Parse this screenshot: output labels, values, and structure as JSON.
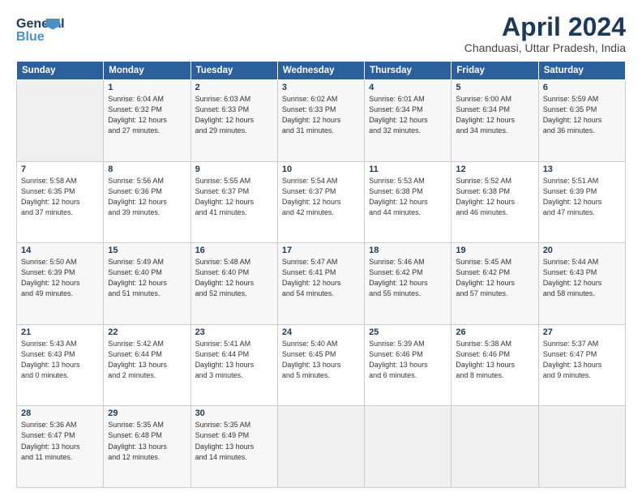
{
  "logo": {
    "line1": "General",
    "line2": "Blue"
  },
  "title": "April 2024",
  "subtitle": "Chanduasi, Uttar Pradesh, India",
  "columns": [
    "Sunday",
    "Monday",
    "Tuesday",
    "Wednesday",
    "Thursday",
    "Friday",
    "Saturday"
  ],
  "weeks": [
    [
      {
        "day": "",
        "info": ""
      },
      {
        "day": "1",
        "info": "Sunrise: 6:04 AM\nSunset: 6:32 PM\nDaylight: 12 hours\nand 27 minutes."
      },
      {
        "day": "2",
        "info": "Sunrise: 6:03 AM\nSunset: 6:33 PM\nDaylight: 12 hours\nand 29 minutes."
      },
      {
        "day": "3",
        "info": "Sunrise: 6:02 AM\nSunset: 6:33 PM\nDaylight: 12 hours\nand 31 minutes."
      },
      {
        "day": "4",
        "info": "Sunrise: 6:01 AM\nSunset: 6:34 PM\nDaylight: 12 hours\nand 32 minutes."
      },
      {
        "day": "5",
        "info": "Sunrise: 6:00 AM\nSunset: 6:34 PM\nDaylight: 12 hours\nand 34 minutes."
      },
      {
        "day": "6",
        "info": "Sunrise: 5:59 AM\nSunset: 6:35 PM\nDaylight: 12 hours\nand 36 minutes."
      }
    ],
    [
      {
        "day": "7",
        "info": "Sunrise: 5:58 AM\nSunset: 6:35 PM\nDaylight: 12 hours\nand 37 minutes."
      },
      {
        "day": "8",
        "info": "Sunrise: 5:56 AM\nSunset: 6:36 PM\nDaylight: 12 hours\nand 39 minutes."
      },
      {
        "day": "9",
        "info": "Sunrise: 5:55 AM\nSunset: 6:37 PM\nDaylight: 12 hours\nand 41 minutes."
      },
      {
        "day": "10",
        "info": "Sunrise: 5:54 AM\nSunset: 6:37 PM\nDaylight: 12 hours\nand 42 minutes."
      },
      {
        "day": "11",
        "info": "Sunrise: 5:53 AM\nSunset: 6:38 PM\nDaylight: 12 hours\nand 44 minutes."
      },
      {
        "day": "12",
        "info": "Sunrise: 5:52 AM\nSunset: 6:38 PM\nDaylight: 12 hours\nand 46 minutes."
      },
      {
        "day": "13",
        "info": "Sunrise: 5:51 AM\nSunset: 6:39 PM\nDaylight: 12 hours\nand 47 minutes."
      }
    ],
    [
      {
        "day": "14",
        "info": "Sunrise: 5:50 AM\nSunset: 6:39 PM\nDaylight: 12 hours\nand 49 minutes."
      },
      {
        "day": "15",
        "info": "Sunrise: 5:49 AM\nSunset: 6:40 PM\nDaylight: 12 hours\nand 51 minutes."
      },
      {
        "day": "16",
        "info": "Sunrise: 5:48 AM\nSunset: 6:40 PM\nDaylight: 12 hours\nand 52 minutes."
      },
      {
        "day": "17",
        "info": "Sunrise: 5:47 AM\nSunset: 6:41 PM\nDaylight: 12 hours\nand 54 minutes."
      },
      {
        "day": "18",
        "info": "Sunrise: 5:46 AM\nSunset: 6:42 PM\nDaylight: 12 hours\nand 55 minutes."
      },
      {
        "day": "19",
        "info": "Sunrise: 5:45 AM\nSunset: 6:42 PM\nDaylight: 12 hours\nand 57 minutes."
      },
      {
        "day": "20",
        "info": "Sunrise: 5:44 AM\nSunset: 6:43 PM\nDaylight: 12 hours\nand 58 minutes."
      }
    ],
    [
      {
        "day": "21",
        "info": "Sunrise: 5:43 AM\nSunset: 6:43 PM\nDaylight: 13 hours\nand 0 minutes."
      },
      {
        "day": "22",
        "info": "Sunrise: 5:42 AM\nSunset: 6:44 PM\nDaylight: 13 hours\nand 2 minutes."
      },
      {
        "day": "23",
        "info": "Sunrise: 5:41 AM\nSunset: 6:44 PM\nDaylight: 13 hours\nand 3 minutes."
      },
      {
        "day": "24",
        "info": "Sunrise: 5:40 AM\nSunset: 6:45 PM\nDaylight: 13 hours\nand 5 minutes."
      },
      {
        "day": "25",
        "info": "Sunrise: 5:39 AM\nSunset: 6:46 PM\nDaylight: 13 hours\nand 6 minutes."
      },
      {
        "day": "26",
        "info": "Sunrise: 5:38 AM\nSunset: 6:46 PM\nDaylight: 13 hours\nand 8 minutes."
      },
      {
        "day": "27",
        "info": "Sunrise: 5:37 AM\nSunset: 6:47 PM\nDaylight: 13 hours\nand 9 minutes."
      }
    ],
    [
      {
        "day": "28",
        "info": "Sunrise: 5:36 AM\nSunset: 6:47 PM\nDaylight: 13 hours\nand 11 minutes."
      },
      {
        "day": "29",
        "info": "Sunrise: 5:35 AM\nSunset: 6:48 PM\nDaylight: 13 hours\nand 12 minutes."
      },
      {
        "day": "30",
        "info": "Sunrise: 5:35 AM\nSunset: 6:49 PM\nDaylight: 13 hours\nand 14 minutes."
      },
      {
        "day": "",
        "info": ""
      },
      {
        "day": "",
        "info": ""
      },
      {
        "day": "",
        "info": ""
      },
      {
        "day": "",
        "info": ""
      }
    ]
  ]
}
